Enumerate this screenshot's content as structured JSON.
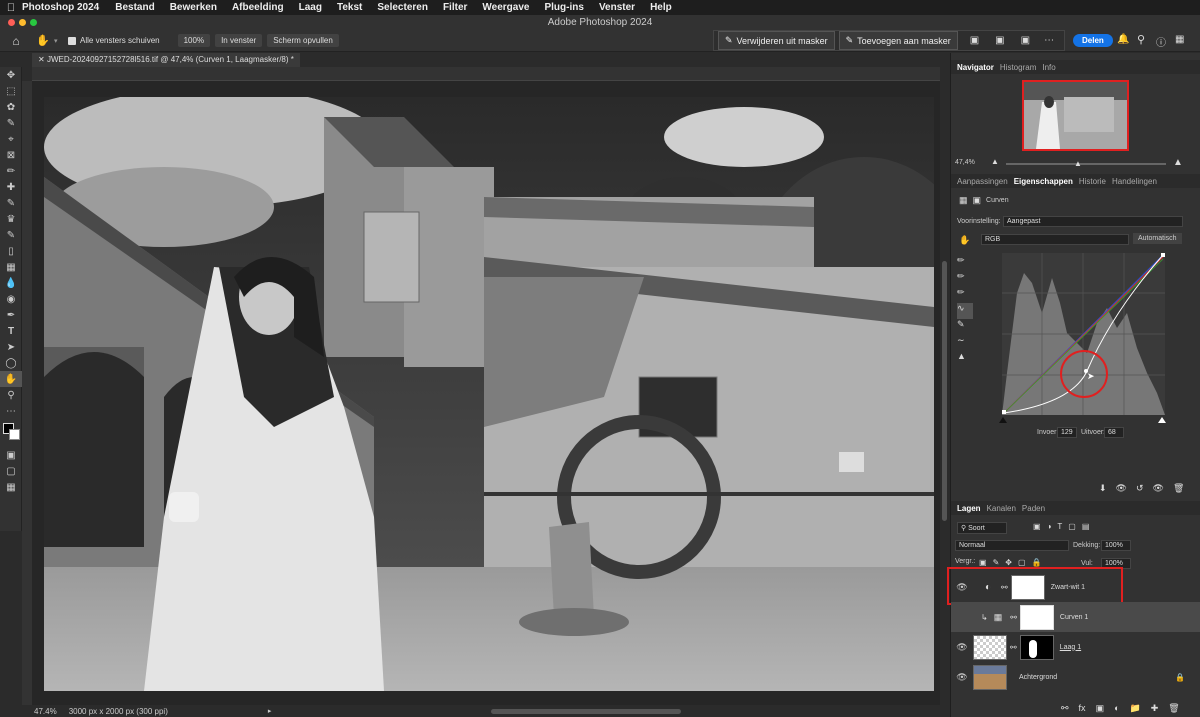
{
  "menubar": {
    "app": "Photoshop 2024",
    "items": [
      "Bestand",
      "Bewerken",
      "Afbeelding",
      "Laag",
      "Tekst",
      "Selecteren",
      "Filter",
      "Weergave",
      "Plug-ins",
      "Venster",
      "Help"
    ]
  },
  "titlebar": {
    "title": "Adobe Photoshop 2024"
  },
  "options": {
    "scroll_all": "Alle vensters schuiven",
    "zoom100": "100%",
    "fit": "In venster",
    "fill": "Scherm opvullen",
    "remove_mask": "Verwijderen uit masker",
    "add_mask": "Toevoegen aan masker",
    "share": "Delen"
  },
  "document": {
    "tab": "JWED-20240927152728l516.tif @ 47,4% (Curven 1, Laagmasker/8) *"
  },
  "status": {
    "zoom": "47.4%",
    "info": "3000 px x 2000 px (300 ppi)"
  },
  "navigator": {
    "tabs": [
      "Navigator",
      "Histogram",
      "Info"
    ],
    "zoom": "47,4%"
  },
  "properties": {
    "tabs": [
      "Aanpassingen",
      "Eigenschappen",
      "Historie",
      "Handelingen"
    ],
    "type": "Curven",
    "preset_label": "Voorinstelling:",
    "preset": "Aangepast",
    "channel": "RGB",
    "auto": "Automatisch",
    "input_label": "Invoer:",
    "input": "129",
    "output_label": "Uitvoer:",
    "output": "68"
  },
  "layers": {
    "tabs": [
      "Lagen",
      "Kanalen",
      "Paden"
    ],
    "kind": "Soort",
    "blend": "Normaal",
    "opacity_label": "Dekking:",
    "opacity": "100%",
    "lock_label": "Vergr.:",
    "fill_label": "Vul:",
    "fill": "100%",
    "items": [
      {
        "name": "Zwart-wit 1"
      },
      {
        "name": "Curven 1"
      },
      {
        "name": "Laag 1"
      },
      {
        "name": "Achtergrond"
      }
    ]
  },
  "colors": {
    "accent": "#1473e6",
    "highlight": "#e02020"
  }
}
